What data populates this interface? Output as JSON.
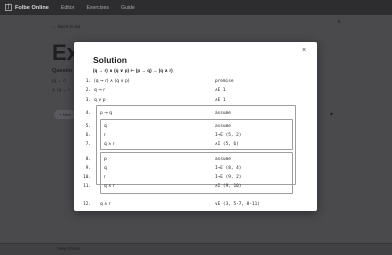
{
  "navbar": {
    "brand": "Folbe Online",
    "links": [
      "Editor",
      "Exercises",
      "Guide"
    ]
  },
  "background": {
    "back_link": "← Back to list",
    "title": "Exa",
    "question_label": "Questio",
    "formula_fragment": "(q → r)",
    "line_fragment": "1. (q → r",
    "pill_label": "+ New",
    "view_rules": "View Rules"
  },
  "modal": {
    "title": "Solution",
    "formula": "(q → r) ∧ (q ∨ p) ⊢ (p → q) → (q ∧ r)",
    "close_icon": "×",
    "rows": [
      {
        "num": "1.",
        "formula": "(q → r) ∧ (q ∨ p)",
        "rule": "premise"
      },
      {
        "num": "2.",
        "formula": "q → r",
        "rule": "∧E 1"
      },
      {
        "num": "3.",
        "formula": "q ∨ p",
        "rule": "∧E 1"
      },
      {
        "num": "4.",
        "formula": "p → q",
        "rule": "assume"
      },
      {
        "num": "5.",
        "formula": "q",
        "rule": "assume"
      },
      {
        "num": "6.",
        "formula": "r",
        "rule": "I→E (5, 2)"
      },
      {
        "num": "7.",
        "formula": "q ∧ r",
        "rule": "∧I (5, 6)"
      },
      {
        "num": "8.",
        "formula": "p",
        "rule": "assume"
      },
      {
        "num": "9.",
        "formula": "q",
        "rule": "I→E (8, 4)"
      },
      {
        "num": "10.",
        "formula": "r",
        "rule": "I→E (9, 2)"
      },
      {
        "num": "11.",
        "formula": "q ∧ r",
        "rule": "∧I (9, 10)"
      },
      {
        "num": "12.",
        "formula": "q ∧ r",
        "rule": "∨E (3, 5-7, 8-11)"
      }
    ]
  }
}
